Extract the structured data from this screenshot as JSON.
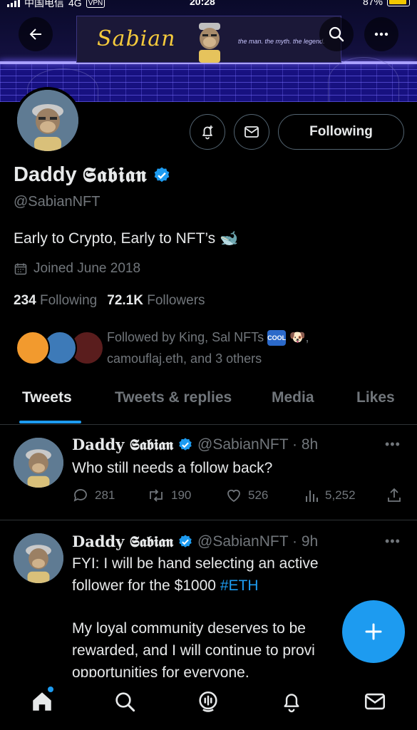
{
  "status_bar": {
    "carrier": "中国电信",
    "network": "4G",
    "vpn": "VPN",
    "time": "20:28",
    "battery": "87%"
  },
  "banner": {
    "sign_title": "Sabian",
    "tagline": "the man. the myth. the legend."
  },
  "profile": {
    "display_name_prefix": "Daddy",
    "display_name_gothic": "𝕾𝖆𝖇𝖎𝖆𝖓",
    "handle": "@SabianNFT",
    "bio": "Early to Crypto, Early to NFT’s",
    "bio_emoji": "🐋",
    "joined": "Joined June 2018",
    "following_count": "234",
    "following_label": "Following",
    "followers_count": "72.1K",
    "followers_label": "Followers",
    "followed_by_line1": "Followed by King, Sal NFTs",
    "followed_by_badge": "COOL",
    "followed_by_emoji": "🐶",
    "followed_by_line2": "camouflaj.eth, and 3 others",
    "follow_button_label": "Following"
  },
  "tabs": [
    {
      "label": "Tweets"
    },
    {
      "label": "Tweets & replies"
    },
    {
      "label": "Media"
    },
    {
      "label": "Likes"
    }
  ],
  "tweets": [
    {
      "name": "Daddy 𝕾𝖆𝖇𝖎𝖆𝖓",
      "handle_time": "@SabianNFT · 8h",
      "text": "Who still needs a follow back?",
      "replies": "281",
      "retweets": "190",
      "likes": "526",
      "views": "5,252"
    },
    {
      "name": "Daddy 𝕾𝖆𝖇𝖎𝖆𝖓",
      "handle_time": "@SabianNFT · 9h",
      "text_line1": "FYI: I will be hand selecting an active",
      "text_line2": "follower for the $1000",
      "hashtag": "#ETH",
      "text_line3": "My loyal community deserves to be",
      "text_line4": "rewarded, and I will continue to provi",
      "text_line5": "opportunities for everyone."
    }
  ],
  "colors": {
    "accent": "#1d9bf0",
    "muted": "#71767b",
    "text": "#e7e9ea",
    "border": "#2f3336"
  },
  "icons": {
    "back": "arrow-left-icon",
    "search": "search-icon",
    "more": "more-horizontal-icon",
    "notify": "bell-plus-icon",
    "message": "envelope-icon",
    "verified": "verified-badge-icon",
    "calendar": "calendar-icon",
    "reply": "reply-icon",
    "retweet": "retweet-icon",
    "like": "heart-icon",
    "views": "views-icon",
    "share": "share-icon",
    "compose": "plus-icon",
    "home": "home-icon",
    "spaces": "spaces-icon",
    "notifications": "bell-icon",
    "messages": "envelope-icon"
  }
}
